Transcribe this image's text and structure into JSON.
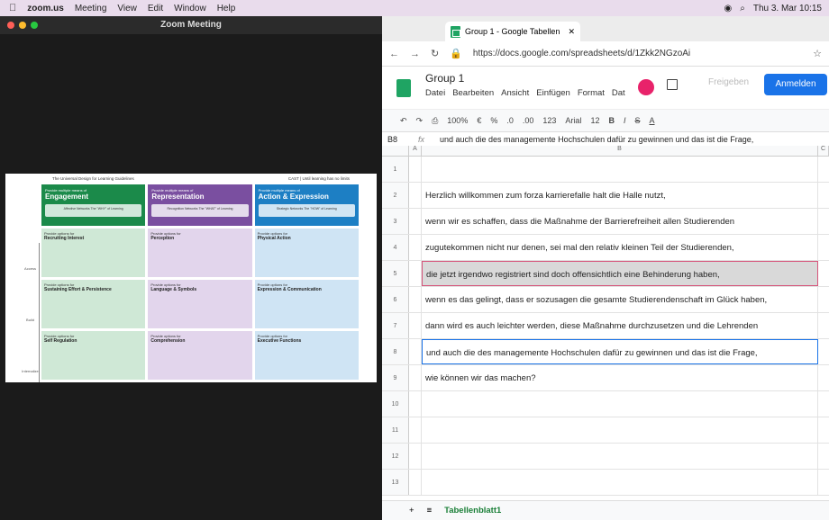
{
  "menubar": {
    "app": "zoom.us",
    "items": [
      "Meeting",
      "View",
      "Edit",
      "Window",
      "Help"
    ],
    "clock": "Thu 3. Mar 10:15"
  },
  "zoom": {
    "title": "Zoom Meeting"
  },
  "udl": {
    "heading": "The Universal Design for Learning Guidelines",
    "cast": "CAST | Until learning has no limits",
    "cols": [
      {
        "pre": "Provide multiple means of",
        "main": "Engagement",
        "sub": "Affective Networks The \"WHY\" of Learning"
      },
      {
        "pre": "Provide multiple means of",
        "main": "Representation",
        "sub": "Recognition Networks The \"WHAT\" of Learning"
      },
      {
        "pre": "Provide multiple means of",
        "main": "Action & Expression",
        "sub": "Strategic Networks The \"HOW\" of Learning"
      }
    ],
    "rows": [
      "Access",
      "Build",
      "Internalize"
    ],
    "cells": [
      [
        "Recruiting Interest",
        "Perception",
        "Physical Action"
      ],
      [
        "Sustaining Effort & Persistence",
        "Language & Symbols",
        "Expression & Communication"
      ],
      [
        "Self Regulation",
        "Comprehension",
        "Executive Functions"
      ]
    ],
    "cellPre": "Provide options for"
  },
  "browser": {
    "tab_title": "Group 1 - Google Tabellen",
    "url": "https://docs.google.com/spreadsheets/d/1Zkk2NGzoAi",
    "doc_title": "Group 1",
    "menu": [
      "Datei",
      "Bearbeiten",
      "Ansicht",
      "Einfügen",
      "Format",
      "Dat"
    ],
    "freigeben": "Freigeben",
    "anmelden": "Anmelden",
    "toolbar": [
      "100%",
      "€",
      "%",
      ".0",
      ".00",
      "123",
      "Arial",
      "12",
      "B",
      "I",
      "S",
      "A"
    ],
    "cell_ref": "B8",
    "formula": "und auch die des managemente Hochschulen dafür zu gewinnen und das ist die Frage,",
    "cols": [
      "A",
      "B",
      "C"
    ],
    "rows": [
      {
        "n": "1",
        "t": ""
      },
      {
        "n": "2",
        "t": "Herzlich willkommen zum forza karrierefalle halt die Halle nutzt,"
      },
      {
        "n": "3",
        "t": "wenn wir es schaffen, dass die Maßnahme der Barrierefreiheit allen Studierenden"
      },
      {
        "n": "4",
        "t": "zugutekommen nicht nur denen, sei mal den relativ kleinen Teil der Studierenden,"
      },
      {
        "n": "5",
        "t": "die jetzt irgendwo registriert sind doch offensichtlich eine Behinderung haben,"
      },
      {
        "n": "6",
        "t": "wenn es das gelingt, dass er sozusagen die gesamte Studierendenschaft im Glück haben,"
      },
      {
        "n": "7",
        "t": "dann wird es auch leichter werden, diese Maßnahme durchzusetzen und die Lehrenden"
      },
      {
        "n": "8",
        "t": "und auch die des managemente Hochschulen dafür zu gewinnen und das ist die Frage,"
      },
      {
        "n": "9",
        "t": "wie können wir das machen?"
      },
      {
        "n": "10",
        "t": ""
      },
      {
        "n": "11",
        "t": ""
      },
      {
        "n": "12",
        "t": ""
      },
      {
        "n": "13",
        "t": ""
      }
    ],
    "sheet_tab": "Tabellenblatt1"
  }
}
